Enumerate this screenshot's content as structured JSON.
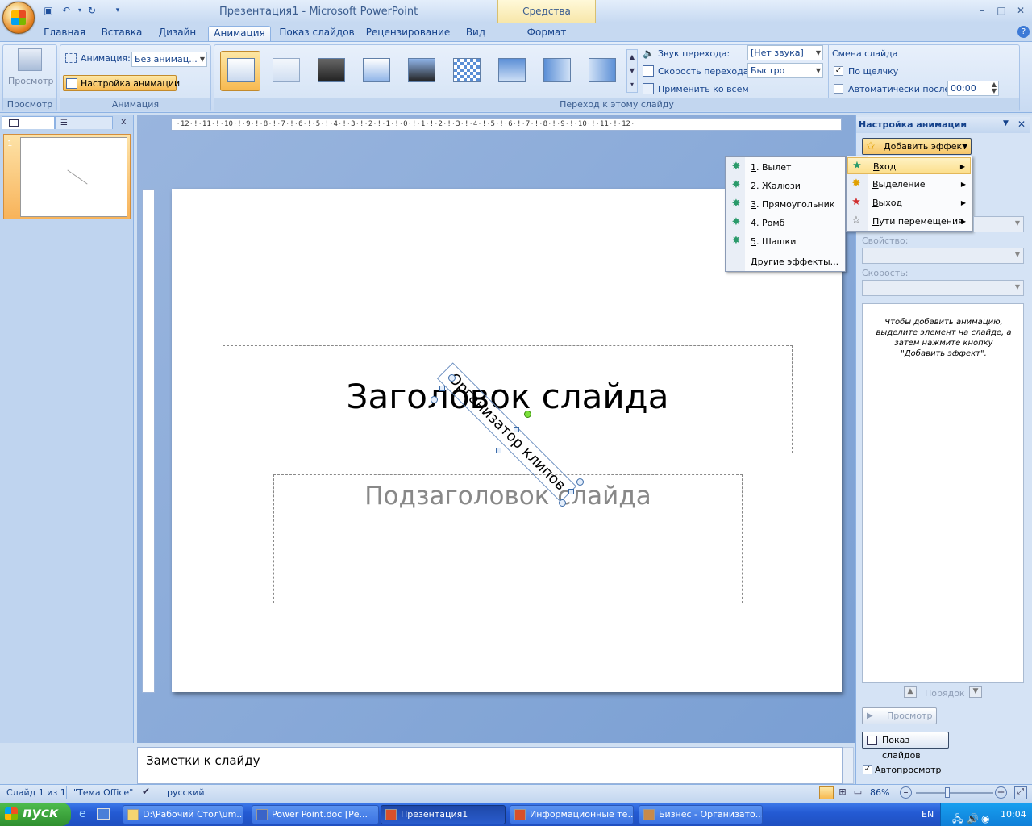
{
  "window": {
    "title": "Презентация1  -  Microsoft PowerPoint",
    "contextual_tab": "Средства рисования",
    "minimize_glyph": "–",
    "maximize_glyph": "□",
    "close_glyph": "✕"
  },
  "tabs": [
    {
      "label": "Главная"
    },
    {
      "label": "Вставка"
    },
    {
      "label": "Дизайн"
    },
    {
      "label": "Анимация",
      "active": true
    },
    {
      "label": "Показ слайдов"
    },
    {
      "label": "Рецензирование"
    },
    {
      "label": "Вид"
    },
    {
      "label": "Формат"
    }
  ],
  "ribbon": {
    "preview_group": {
      "button": "Просмотр",
      "label": "Просмотр"
    },
    "animation_group": {
      "animation_label": "Анимация:",
      "animation_value": "Без анимац...",
      "custom_button": "Настройка анимации",
      "label": "Анимация"
    },
    "transition_group": {
      "label": "Переход к этому слайду",
      "sound_label": "Звук перехода:",
      "sound_value": "[Нет звука]",
      "speed_label": "Скорость перехода:",
      "speed_value": "Быстро",
      "apply_all": "Применить ко всем"
    },
    "advance_group": {
      "title": "Смена слайда",
      "on_click": "По щелчку",
      "on_click_checked": true,
      "auto_after": "Автоматически после:",
      "auto_after_checked": false,
      "time_value": "00:00"
    }
  },
  "slides_pane": {
    "slide_number": "1",
    "close_glyph": "x"
  },
  "slide": {
    "title": "Заголовок слайда",
    "subtitle": "Подзаголовок слайда",
    "clip_text": "Организатор клипов"
  },
  "notes": {
    "text": "Заметки к слайду"
  },
  "taskpane": {
    "title": "Настройка анимации",
    "add_effect": "Добавить эффект",
    "property_label": "Свойство:",
    "speed_label": "Скорость:",
    "hint": "Чтобы добавить анимацию, выделите элемент на слайде, а затем нажмите кнопку \"Добавить эффект\".",
    "order_label": "Порядок",
    "preview_button": "Просмотр",
    "slideshow_button": "Показ слайдов",
    "autopreview": "Автопросмотр",
    "autopreview_checked": true
  },
  "add_effect_menu": [
    {
      "label": "Вход",
      "accel": "В",
      "rest": "ход",
      "highlighted": true
    },
    {
      "label": "Выделение",
      "accel": "В",
      "rest": "ыделение"
    },
    {
      "label": "Выход",
      "accel": "В",
      "rest": "ыход"
    },
    {
      "label": "Пути перемещения",
      "accel": "П",
      "rest": "ути перемещения"
    }
  ],
  "entrance_submenu": [
    {
      "num": "1",
      "name": ". Вылет"
    },
    {
      "num": "2",
      "name": ". Жалюзи"
    },
    {
      "num": "3",
      "name": ". Прямоугольник"
    },
    {
      "num": "4",
      "name": ". Ромб"
    },
    {
      "num": "5",
      "name": ". Шашки"
    },
    {
      "name": "Другие эффекты..."
    }
  ],
  "statusbar": {
    "slide_info": "Слайд 1 из 1",
    "theme": "\"Тема Office\"",
    "language": "русский",
    "zoom": "86%"
  },
  "taskbar": {
    "start": "пуск",
    "items": [
      {
        "label": "D:\\Рабочий Стол\\um..."
      },
      {
        "label": "Power Point.doc [Ре..."
      },
      {
        "label": "Презентация1",
        "active": true
      },
      {
        "label": "Информационные те..."
      },
      {
        "label": "Бизнес - Организато..."
      }
    ],
    "lang": "EN",
    "clock": "10:04"
  },
  "colors": {
    "accent": "#15428b",
    "ribbon_bg": "#c8daf2",
    "highlight": "#fcdf8c"
  }
}
